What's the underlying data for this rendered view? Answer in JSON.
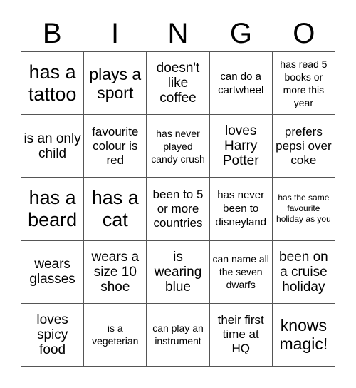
{
  "header": {
    "letters": [
      "B",
      "I",
      "N",
      "G",
      "O"
    ]
  },
  "cells": [
    {
      "text": "has a tattoo",
      "size": "s-xl"
    },
    {
      "text": "plays a sport",
      "size": "s-l"
    },
    {
      "text": "doesn't like coffee",
      "size": "s-m"
    },
    {
      "text": "can do a cartwheel",
      "size": "s-s"
    },
    {
      "text": "has read 5 books or more this year",
      "size": "s-xs"
    },
    {
      "text": "is an only child",
      "size": "s-m"
    },
    {
      "text": "favourite colour is red",
      "size": "s-ms"
    },
    {
      "text": "has never played candy crush",
      "size": "s-xs"
    },
    {
      "text": "loves Harry Potter",
      "size": "s-m"
    },
    {
      "text": "prefers pepsi over coke",
      "size": "s-ms"
    },
    {
      "text": "has a beard",
      "size": "s-xl"
    },
    {
      "text": "has a cat",
      "size": "s-xl"
    },
    {
      "text": "been to 5 or more countries",
      "size": "s-ms"
    },
    {
      "text": "has never been to disneyland",
      "size": "s-s"
    },
    {
      "text": "has the same favourite holiday as you",
      "size": "s-xxs"
    },
    {
      "text": "wears glasses",
      "size": "s-m"
    },
    {
      "text": "wears a size 10 shoe",
      "size": "s-m"
    },
    {
      "text": "is wearing blue",
      "size": "s-m"
    },
    {
      "text": "can name all the seven dwarfs",
      "size": "s-xs"
    },
    {
      "text": "been on a cruise holiday",
      "size": "s-m"
    },
    {
      "text": "loves spicy food",
      "size": "s-m"
    },
    {
      "text": "is a vegeterian",
      "size": "s-xs"
    },
    {
      "text": "can play an instrument",
      "size": "s-xs"
    },
    {
      "text": "their first time at HQ",
      "size": "s-ms"
    },
    {
      "text": "knows magic!",
      "size": "s-l"
    }
  ]
}
